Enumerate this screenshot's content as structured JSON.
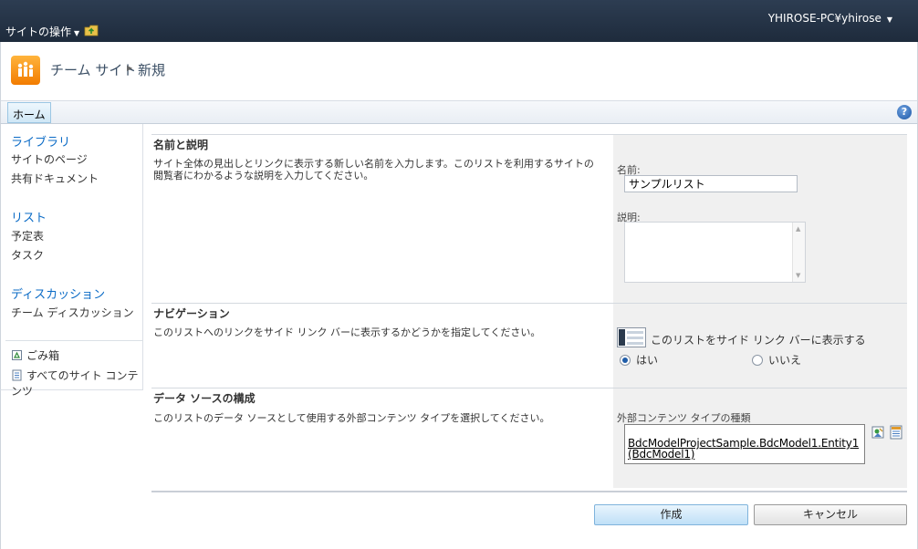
{
  "topbar": {
    "site_actions": "サイトの操作",
    "user": "YHIROSE-PC¥yhirose"
  },
  "breadcrumb": {
    "site": "チーム サイト",
    "page": "新規"
  },
  "topnav": {
    "home_tab": "ホーム",
    "help": "?"
  },
  "quicklaunch": {
    "libraries_heading": "ライブラリ",
    "site_pages": "サイトのページ",
    "shared_documents": "共有ドキュメント",
    "lists_heading": "リスト",
    "calendar": "予定表",
    "tasks": "タスク",
    "discussions_heading": "ディスカッション",
    "team_discussion": "チーム ディスカッション",
    "recycle_bin": "ごみ箱",
    "all_site_content": "すべてのサイト コンテンツ"
  },
  "form": {
    "name_section": {
      "title": "名前と説明",
      "description": "サイト全体の見出しとリンクに表示する新しい名前を入力します。このリストを利用するサイトの閲覧者にわかるような説明を入力してください。",
      "name_label": "名前:",
      "name_value": "サンプルリスト",
      "desc_label": "説明:"
    },
    "nav_section": {
      "title": "ナビゲーション",
      "description": "このリストへのリンクをサイド リンク バーに表示するかどうかを指定してください。",
      "option_label": "このリストをサイド リンク バーに表示する",
      "yes": "はい",
      "no": "いいえ"
    },
    "datasource_section": {
      "title": "データ ソースの構成",
      "description": "このリストのデータ ソースとして使用する外部コンテンツ タイプを選択してください。",
      "type_label": "外部コンテンツ タイプの種類",
      "type_value_line1": "BdcModelProjectSample.BdcModel1.Entity1",
      "type_value_line2": "(BdcModel1)"
    }
  },
  "buttons": {
    "create": "作成",
    "cancel": "キャンセル"
  },
  "colors": {
    "topbar": "#1e2b3c",
    "link_blue": "#0b6bc6",
    "panel_gray": "#f0f0f0"
  }
}
